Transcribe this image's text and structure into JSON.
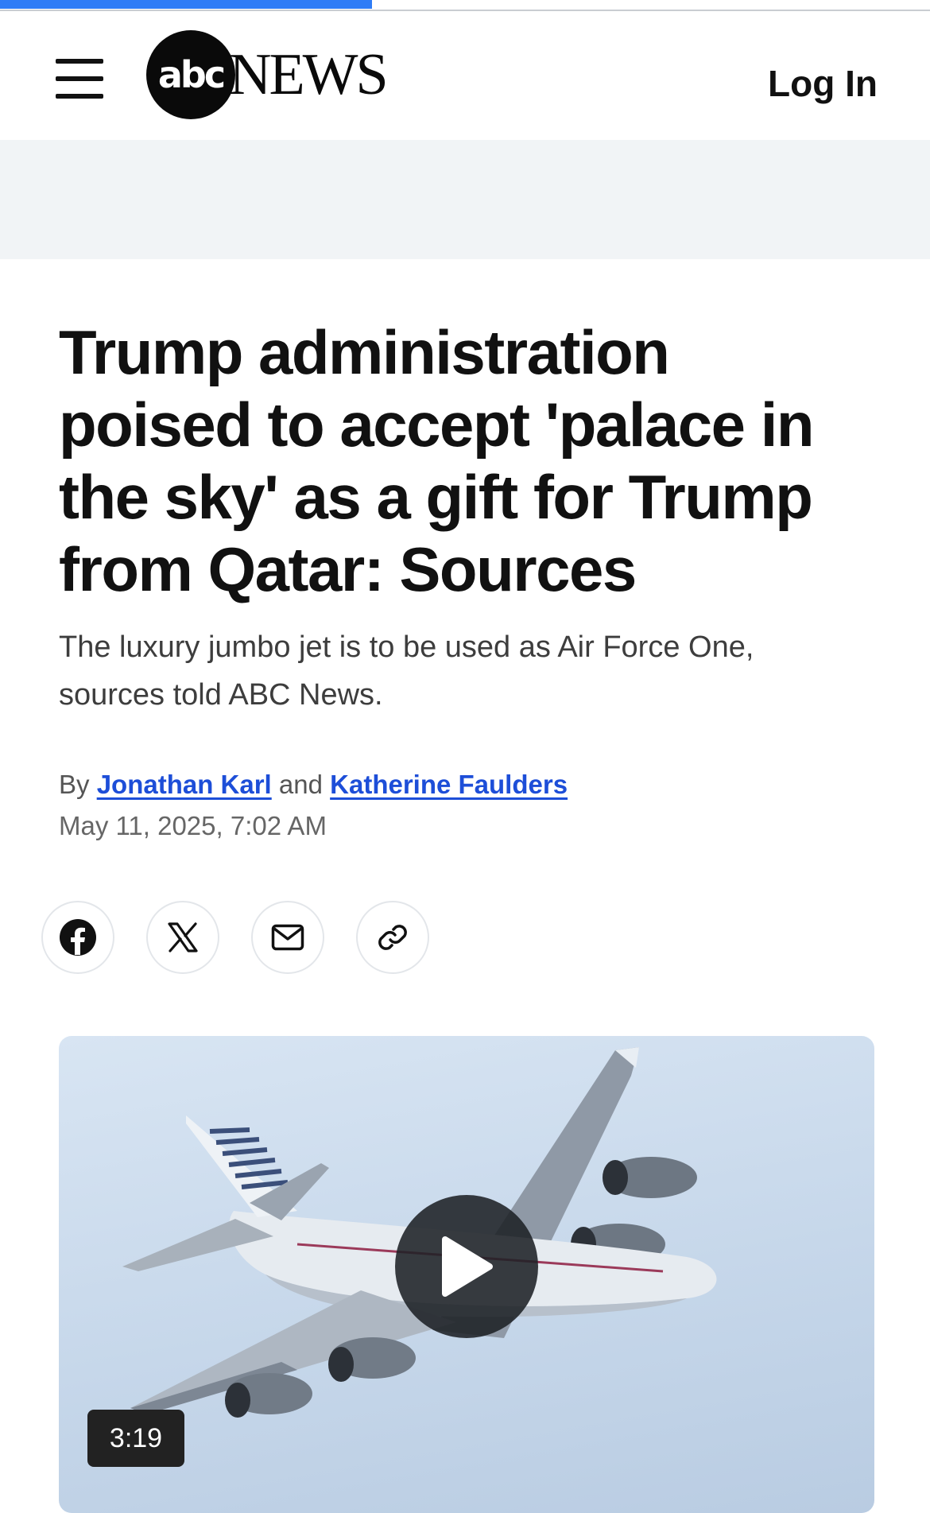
{
  "page": {
    "reading_progress_percent": 40
  },
  "header": {
    "menu_icon": "hamburger-menu-icon",
    "logo": {
      "mark": "abc",
      "word": "NEWS"
    },
    "login_label": "Log In"
  },
  "article": {
    "headline": "Trump administration poised to accept 'palace in the sky' as a gift for Trump from Qatar: Sources",
    "dek": "The luxury jumbo jet is to be used as Air Force One, sources told ABC News.",
    "byline": {
      "prefix": "By",
      "author1": "Jonathan Karl",
      "conjunction": "and",
      "author2": "Katherine Faulders"
    },
    "date": "May 11, 2025, 7:02 AM"
  },
  "share": {
    "buttons": [
      {
        "icon": "facebook-icon"
      },
      {
        "icon": "x-icon"
      },
      {
        "icon": "email-icon"
      },
      {
        "icon": "link-icon"
      }
    ]
  },
  "video": {
    "duration": "3:19",
    "play_icon": "play-icon"
  },
  "colors": {
    "progress": "#2f7cf6",
    "link": "#1d4ed8",
    "ad_background": "#f1f4f6"
  }
}
